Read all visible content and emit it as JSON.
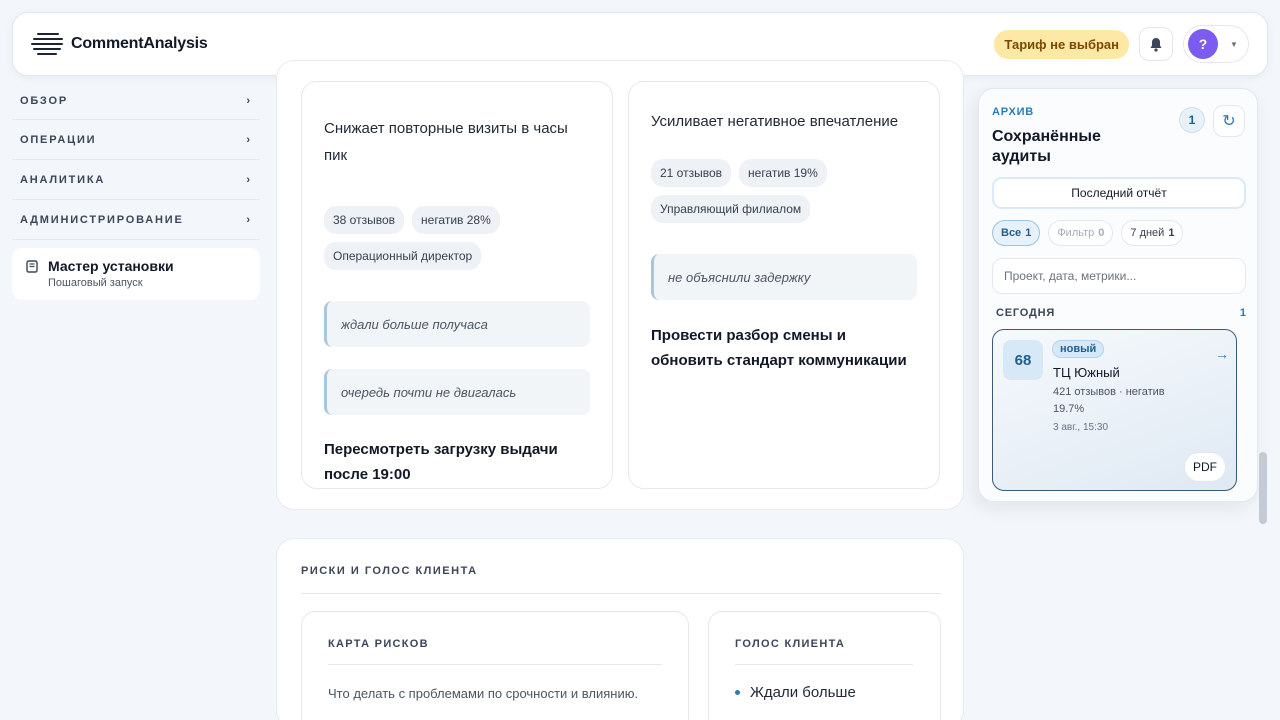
{
  "header": {
    "logo_text": "CommentAnalysis",
    "plan_badge": "Тариф не выбран",
    "avatar_initial": "?"
  },
  "sidebar": {
    "items": [
      {
        "label": "ОБЗОР"
      },
      {
        "label": "ОПЕРАЦИИ"
      },
      {
        "label": "АНАЛИТИКА"
      },
      {
        "label": "АДМИНИСТРИРОВАНИЕ"
      }
    ],
    "chevron": "›",
    "wizard": {
      "title": "Мастер установки",
      "subtitle": "Пошаговый запуск"
    }
  },
  "insights": [
    {
      "title": "Снижает повторные визиты в часы пик",
      "tags": [
        "38 отзывов",
        "негатив 28%",
        "Операционный директор"
      ],
      "quotes": [
        "ждали больше получаса",
        "очередь почти не двигалась"
      ],
      "action": "Пересмотреть загрузку выдачи после 19:00"
    },
    {
      "title": "Усиливает негативное впечатление",
      "tags": [
        "21 отзывов",
        "негатив 19%",
        "Управляющий филиалом"
      ],
      "quotes": [
        "не объяснили задержку"
      ],
      "action": "Провести разбор смены и обновить стандарт коммуникации"
    }
  ],
  "risks": {
    "section_title": "РИСКИ И ГОЛОС КЛИЕНТА",
    "risk_map": {
      "title": "КАРТА РИСКОВ",
      "text": "Что делать с проблемами по срочности и влиянию."
    },
    "voice": {
      "title": "ГОЛОС КЛИЕНТА",
      "items": [
        "Ждали больше"
      ]
    }
  },
  "archive": {
    "kicker": "АРХИВ",
    "title": "Сохранённые аудиты",
    "count": "1",
    "last_report_label": "Последний отчёт",
    "filters": [
      {
        "label": "Все",
        "count": "1"
      },
      {
        "label": "Фильтр",
        "count": "0"
      },
      {
        "label": "7 дней",
        "count": "1"
      }
    ],
    "search_placeholder": "Проект, дата, метрики...",
    "group_label": "СЕГОДНЯ",
    "group_count": "1",
    "audit": {
      "score": "68",
      "badge": "новый",
      "name": "ТЦ Южный",
      "meta": "421 отзывов · негатив 19.7%",
      "date": "3 авг., 15:30",
      "pdf_label": "PDF"
    }
  },
  "colors": {
    "accent": "#2b7bb9",
    "plan_badge_bg": "#fde8a6",
    "avatar": "#7c5cf0"
  }
}
